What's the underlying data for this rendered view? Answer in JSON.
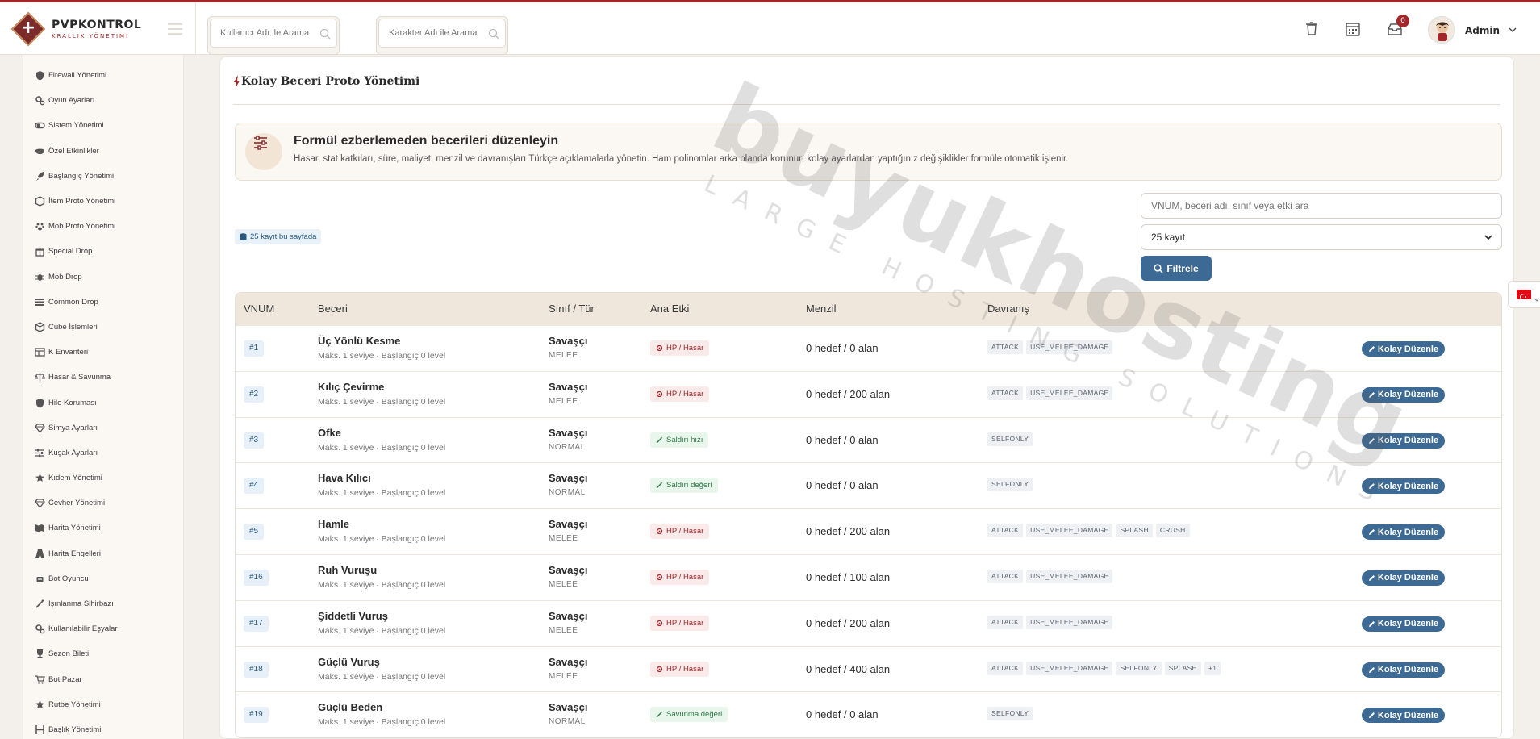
{
  "brand": {
    "title": "PVPKONTROL",
    "subtitle": "KRALLIK YÖNETIMI"
  },
  "header": {
    "user_search_placeholder": "Kullanıcı Adı ile Arama",
    "char_search_placeholder": "Karakter Adı ile Arama",
    "notification_count": "0",
    "admin_name": "Admin"
  },
  "sidebar": {
    "items": [
      {
        "label": "Firewall Yönetimi",
        "icon": "shield-icon"
      },
      {
        "label": "Oyun Ayarları",
        "icon": "gears-icon"
      },
      {
        "label": "Sistem Yönetimi",
        "icon": "toggle-icon"
      },
      {
        "label": "Özel Etkinlikler",
        "icon": "mask-icon"
      },
      {
        "label": "Başlangıç Yönetimi",
        "icon": "rocket-icon"
      },
      {
        "label": "İtem Proto Yönetimi",
        "icon": "box-icon"
      },
      {
        "label": "Mob Proto Yönetimi",
        "icon": "paw-icon"
      },
      {
        "label": "Special Drop",
        "icon": "gift-icon"
      },
      {
        "label": "Mob Drop",
        "icon": "bug-icon"
      },
      {
        "label": "Common Drop",
        "icon": "list-icon"
      },
      {
        "label": "Cube İşlemleri",
        "icon": "cube-icon"
      },
      {
        "label": "K Envanteri",
        "icon": "table-icon"
      },
      {
        "label": "Hasar & Savunma",
        "icon": "scale-icon"
      },
      {
        "label": "Hile Koruması",
        "icon": "shield-icon"
      },
      {
        "label": "Simya Ayarları",
        "icon": "gem-icon"
      },
      {
        "label": "Kuşak Ayarları",
        "icon": "sliders-icon"
      },
      {
        "label": "Kıdem Yönetimi",
        "icon": "star-icon"
      },
      {
        "label": "Cevher Yönetimi",
        "icon": "gem-icon"
      },
      {
        "label": "Harita Yönetimi",
        "icon": "map-icon"
      },
      {
        "label": "Harita Engelleri",
        "icon": "road-icon"
      },
      {
        "label": "Bot Oyuncu",
        "icon": "robot-icon"
      },
      {
        "label": "Işınlanma Sihirbazı",
        "icon": "wand-icon"
      },
      {
        "label": "Kullanılabilir Eşyalar",
        "icon": "gears-icon"
      },
      {
        "label": "Sezon Bileti",
        "icon": "trophy-icon"
      },
      {
        "label": "Bot Pazar",
        "icon": "cart-icon"
      },
      {
        "label": "Rutbe Yönetimi",
        "icon": "star-icon"
      },
      {
        "label": "Başlık Yönetimi",
        "icon": "heading-icon"
      }
    ]
  },
  "page": {
    "title": "Kolay Beceri Proto Yönetimi",
    "banner_title": "Formül ezberlemeden becerileri düzenleyin",
    "banner_desc": "Hasar, stat katkıları, süre, maliyet, menzil ve davranışları Türkçe açıklamalarla yönetin. Ham polinomlar arka planda korunur; kolay ayarlardan yaptığınız değişiklikler formüle otomatik işlenir.",
    "count_label": "25 kayıt bu sayfada",
    "search_placeholder": "VNUM, beceri adı, sınıf veya etki ara",
    "per_page": "25 kayıt",
    "filter_button": "Filtrele"
  },
  "table": {
    "headers": [
      "VNUM",
      "Beceri",
      "Sınıf / Tür",
      "Ana Etki",
      "Menzil",
      "Davranış"
    ],
    "edit_label": "Kolay Düzenle",
    "rows": [
      {
        "vnum": "#1",
        "name": "Üç Yönlü Kesme",
        "sub": "Maks. 1 seviye · Başlangıç 0 level",
        "cls": "Savaşçı",
        "type": "MELEE",
        "effect": "HP / Hasar",
        "effect_kind": "hp",
        "range": "0 hedef / 0 alan",
        "tags": [
          "ATTACK",
          "USE_MELEE_DAMAGE"
        ]
      },
      {
        "vnum": "#2",
        "name": "Kılıç Çevirme",
        "sub": "Maks. 1 seviye · Başlangıç 0 level",
        "cls": "Savaşçı",
        "type": "MELEE",
        "effect": "HP / Hasar",
        "effect_kind": "hp",
        "range": "0 hedef / 200 alan",
        "tags": [
          "ATTACK",
          "USE_MELEE_DAMAGE"
        ]
      },
      {
        "vnum": "#3",
        "name": "Öfke",
        "sub": "Maks. 1 seviye · Başlangıç 0 level",
        "cls": "Savaşçı",
        "type": "NORMAL",
        "effect": "Saldırı hızı",
        "effect_kind": "green",
        "range": "0 hedef / 0 alan",
        "tags": [
          "SELFONLY"
        ]
      },
      {
        "vnum": "#4",
        "name": "Hava Kılıcı",
        "sub": "Maks. 1 seviye · Başlangıç 0 level",
        "cls": "Savaşçı",
        "type": "NORMAL",
        "effect": "Saldırı değeri",
        "effect_kind": "green",
        "range": "0 hedef / 0 alan",
        "tags": [
          "SELFONLY"
        ]
      },
      {
        "vnum": "#5",
        "name": "Hamle",
        "sub": "Maks. 1 seviye · Başlangıç 0 level",
        "cls": "Savaşçı",
        "type": "MELEE",
        "effect": "HP / Hasar",
        "effect_kind": "hp",
        "range": "0 hedef / 200 alan",
        "tags": [
          "ATTACK",
          "USE_MELEE_DAMAGE",
          "SPLASH",
          "CRUSH"
        ]
      },
      {
        "vnum": "#16",
        "name": "Ruh Vuruşu",
        "sub": "Maks. 1 seviye · Başlangıç 0 level",
        "cls": "Savaşçı",
        "type": "MELEE",
        "effect": "HP / Hasar",
        "effect_kind": "hp",
        "range": "0 hedef / 100 alan",
        "tags": [
          "ATTACK",
          "USE_MELEE_DAMAGE"
        ]
      },
      {
        "vnum": "#17",
        "name": "Şiddetli Vuruş",
        "sub": "Maks. 1 seviye · Başlangıç 0 level",
        "cls": "Savaşçı",
        "type": "MELEE",
        "effect": "HP / Hasar",
        "effect_kind": "hp",
        "range": "0 hedef / 200 alan",
        "tags": [
          "ATTACK",
          "USE_MELEE_DAMAGE"
        ]
      },
      {
        "vnum": "#18",
        "name": "Güçlü Vuruş",
        "sub": "Maks. 1 seviye · Başlangıç 0 level",
        "cls": "Savaşçı",
        "type": "MELEE",
        "effect": "HP / Hasar",
        "effect_kind": "hp",
        "range": "0 hedef / 400 alan",
        "tags": [
          "ATTACK",
          "USE_MELEE_DAMAGE",
          "SELFONLY",
          "SPLASH",
          "+1"
        ]
      },
      {
        "vnum": "#19",
        "name": "Güçlü Beden",
        "sub": "Maks. 1 seviye · Başlangıç 0 level",
        "cls": "Savaşçı",
        "type": "NORMAL",
        "effect": "Savunma değeri",
        "effect_kind": "green",
        "range": "0 hedef / 0 alan",
        "tags": [
          "SELFONLY"
        ]
      }
    ]
  },
  "watermark": {
    "main": "buyukhosting",
    "sub": "LARGE HOSTING SOLUTIONS"
  },
  "colors": {
    "accent": "#a3262a",
    "primary_button": "#3d6a94",
    "header_bg": "#efe7dc"
  }
}
